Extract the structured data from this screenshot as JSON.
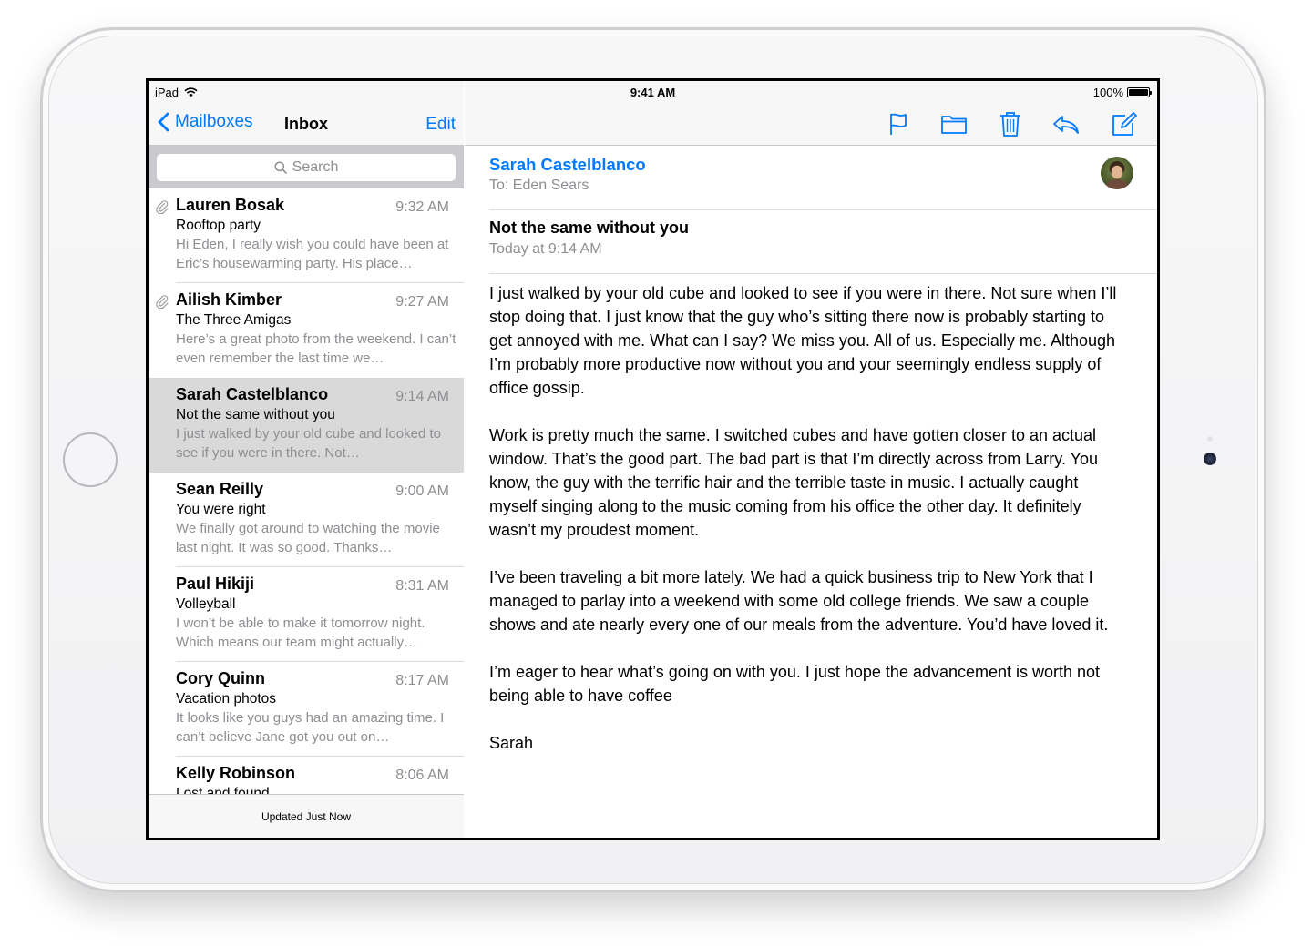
{
  "status_bar": {
    "carrier": "iPad",
    "time": "9:41 AM",
    "battery_percent": "100%"
  },
  "sidebar": {
    "back_label": "Mailboxes",
    "title": "Inbox",
    "edit_label": "Edit",
    "search_placeholder": "Search",
    "footer_status": "Updated Just Now",
    "messages": [
      {
        "sender": "Lauren Bosak",
        "time": "9:32 AM",
        "subject": "Rooftop party",
        "preview": "Hi Eden, I really wish you could have been at Eric’s housewarming party. His place…",
        "attachment": true,
        "selected": false
      },
      {
        "sender": "Ailish Kimber",
        "time": "9:27 AM",
        "subject": "The Three Amigas",
        "preview": "Here’s a great photo from the weekend. I can’t even remember the last time we…",
        "attachment": true,
        "selected": false
      },
      {
        "sender": "Sarah Castelblanco",
        "time": "9:14 AM",
        "subject": "Not the same without you",
        "preview": "I just walked by your old cube and looked to see if you were in there. Not…",
        "attachment": false,
        "selected": true
      },
      {
        "sender": "Sean Reilly",
        "time": "9:00 AM",
        "subject": "You were right",
        "preview": "We finally got around to watching the movie last night. It was so good. Thanks…",
        "attachment": false,
        "selected": false
      },
      {
        "sender": "Paul Hikiji",
        "time": "8:31 AM",
        "subject": "Volleyball",
        "preview": "I won’t be able to make it tomorrow night. Which means our team might actually…",
        "attachment": false,
        "selected": false
      },
      {
        "sender": "Cory Quinn",
        "time": "8:17 AM",
        "subject": "Vacation photos",
        "preview": "It looks like you guys had an amazing time. I can’t believe Jane got you out on…",
        "attachment": false,
        "selected": false
      },
      {
        "sender": "Kelly Robinson",
        "time": "8:06 AM",
        "subject": "Lost and found",
        "preview": "",
        "attachment": false,
        "selected": false
      }
    ]
  },
  "toolbar": {
    "icons": [
      "flag-icon",
      "folder-icon",
      "trash-icon",
      "reply-icon",
      "compose-icon"
    ]
  },
  "message": {
    "from": "Sarah Castelblanco",
    "to": "To: Eden Sears",
    "subject": "Not the same without you",
    "date": "Today at 9:14 AM",
    "paragraphs": [
      "I just walked by your old cube and looked to see if you were in there. Not sure when I’ll stop doing that. I just know that the guy who’s sitting there now is probably starting to get annoyed with me. What can I say? We miss you. All of us. Especially me. Although I’m probably more productive now without you and your seemingly endless supply of office gossip.",
      "Work is pretty much the same. I switched cubes and have gotten closer to an actual window. That’s the good part. The bad part is that I’m directly across from Larry. You know, the guy with the terrific hair and the terrible taste in music. I actually caught myself singing along to the music coming from his office the other day. It definitely wasn’t my proudest moment.",
      "I’ve been traveling a bit more lately. We had a quick business trip to New York that I managed to parlay into a weekend with some old college friends. We saw a couple shows and ate nearly every one of our meals from the adventure. You’d have loved it.",
      "I’m eager to hear what’s going on with you. I just hope the advancement is worth not being able to have coffee",
      "Sarah"
    ]
  }
}
